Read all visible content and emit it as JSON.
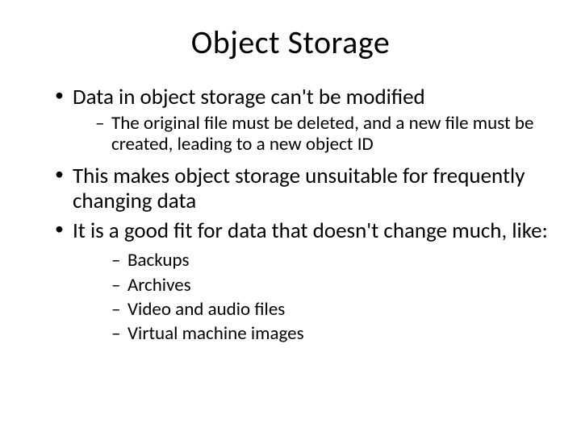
{
  "title": "Object Storage",
  "bullets": {
    "b0": "Data in object storage can't be modified",
    "b0_sub0": "The original file must be deleted, and a new file must be created, leading to a new object ID",
    "b1": "This makes object storage unsuitable for frequently changing data",
    "b2": "It is a good fit for data that doesn't change much, like:",
    "b2_sub0": "Backups",
    "b2_sub1": "Archives",
    "b2_sub2": "Video and audio files",
    "b2_sub3": "Virtual machine images"
  }
}
